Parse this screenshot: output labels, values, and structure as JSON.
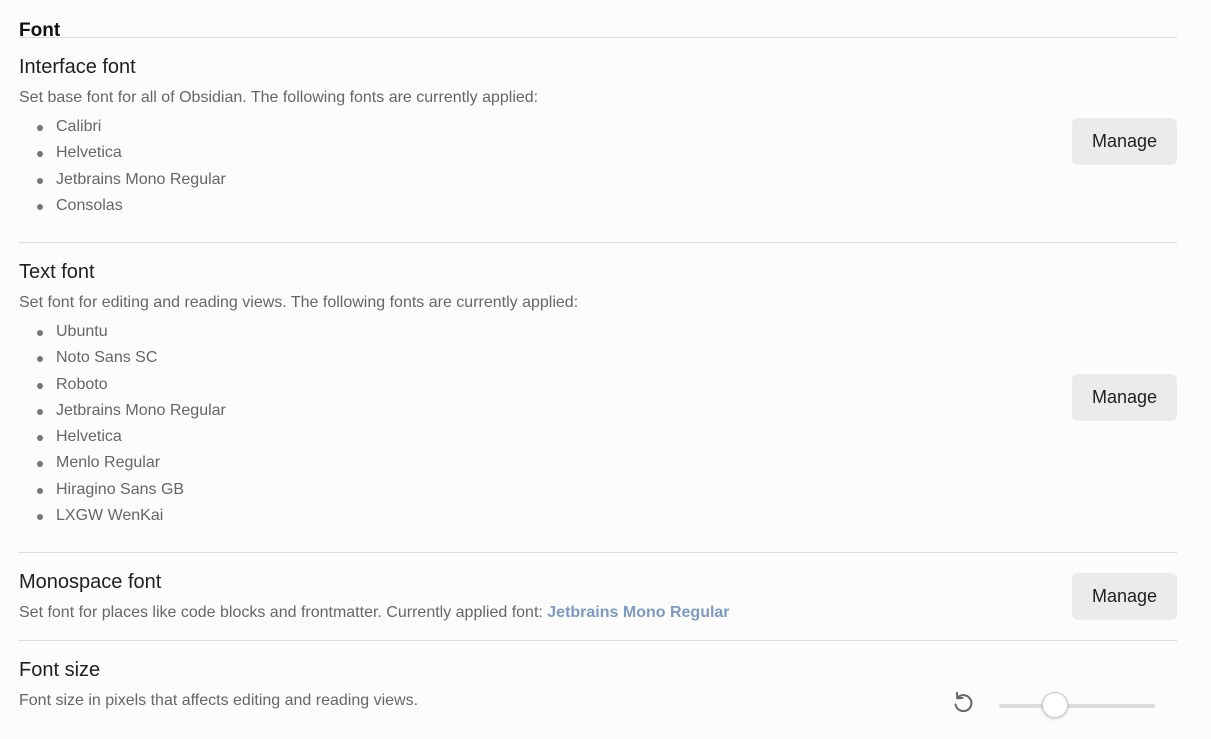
{
  "section": {
    "heading": "Font"
  },
  "interface_font": {
    "name": "Interface font",
    "description": "Set base font for all of Obsidian. The following fonts are currently applied:",
    "fonts": [
      "Calibri",
      "Helvetica",
      "Jetbrains Mono Regular",
      "Consolas"
    ],
    "button_label": "Manage"
  },
  "text_font": {
    "name": "Text font",
    "description": "Set font for editing and reading views. The following fonts are currently applied:",
    "fonts": [
      "Ubuntu",
      "Noto Sans SC",
      "Roboto",
      "Jetbrains Mono Regular",
      "Helvetica",
      "Menlo Regular",
      "Hiragino Sans GB",
      "LXGW WenKai"
    ],
    "button_label": "Manage"
  },
  "monospace_font": {
    "name": "Monospace font",
    "description": "Set font for places like code blocks and frontmatter. Currently applied font: ",
    "applied_font": "Jetbrains Mono Regular",
    "button_label": "Manage"
  },
  "font_size": {
    "name": "Font size",
    "description": "Font size in pixels that affects editing and reading views.",
    "reset_icon": "reset-icon",
    "slider_fraction": 0.37
  },
  "colors": {
    "accent": "#7d9ac2",
    "button_bg": "#ebebeb",
    "divider": "#dcdcdc"
  }
}
